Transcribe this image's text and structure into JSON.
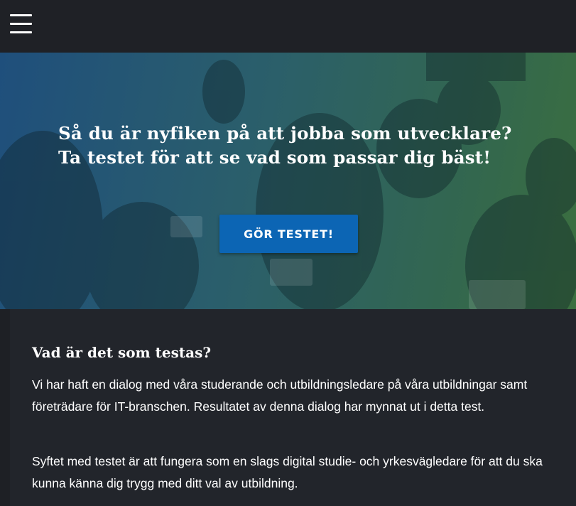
{
  "header": {
    "menu_icon": "hamburger-menu-icon"
  },
  "hero": {
    "title_line1": "Så du är nyfiken på att jobba som utvecklare?",
    "title_line2": "Ta testet för att se vad som passar dig bäst!",
    "cta_label": "GÖR TESTET!",
    "overlay_colors": [
      "#1f4f7c",
      "#3b6f3f"
    ],
    "button_color": "#0c65b4"
  },
  "content": {
    "heading": "Vad är det som testas?",
    "paragraph1": "Vi har haft en dialog med våra studerande och utbildningsledare på våra utbildningar samt företrädare för IT-branschen. Resultatet av denna dialog har mynnat ut i detta test.",
    "paragraph2": "Syftet med testet är att fungera som en slags digital studie- och yrkesvägledare för att du ska kunna känna dig trygg med ditt val av utbildning."
  }
}
